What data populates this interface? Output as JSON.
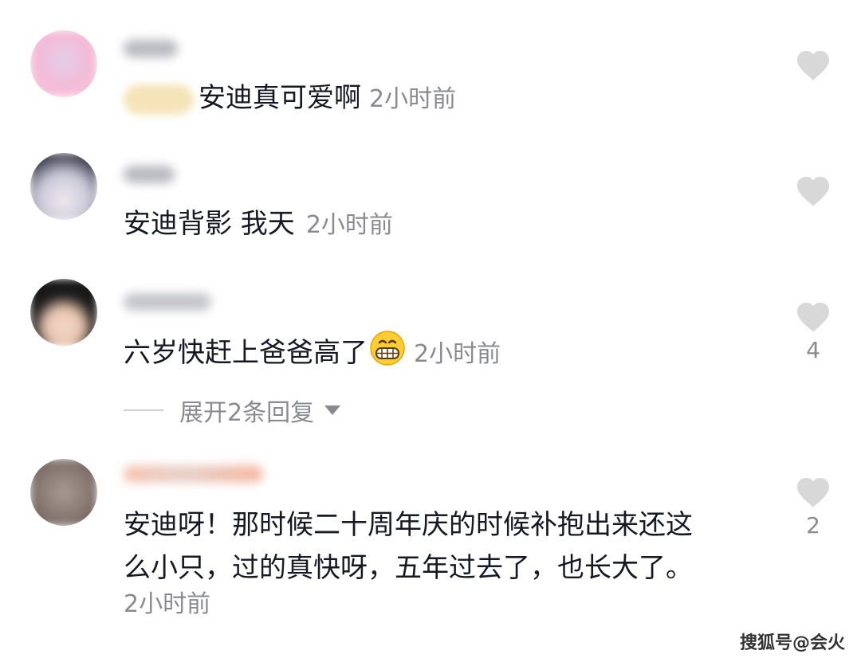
{
  "comments": [
    {
      "text": "安迪真可爱啊",
      "time": "2小时前",
      "likes": ""
    },
    {
      "text": "安迪背影 我天",
      "time": "2小时前",
      "likes": ""
    },
    {
      "text": "六岁快赶上爸爸高了",
      "time": "2小时前",
      "likes": "4",
      "emoji": "grinning-face-icon"
    },
    {
      "text_line1": "安迪呀！那时候二十周年庆的时候补抱出来还这",
      "text_line2": "么小只，过的真快呀，五年过去了，也长大了。",
      "time": "2小时前",
      "likes": "2"
    }
  ],
  "expand_replies": {
    "label": "展开2条回复"
  },
  "watermark": "搜狐号@会火",
  "colors": {
    "text": "#161823",
    "secondary": "#8a8b91",
    "heart": "#d8d8d8"
  }
}
